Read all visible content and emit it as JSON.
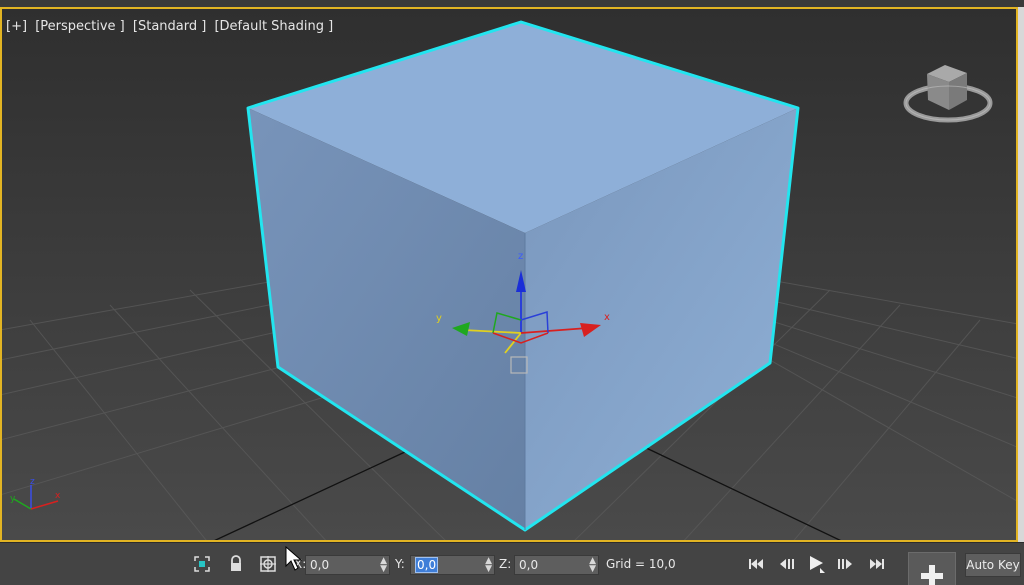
{
  "viewport": {
    "labels": [
      "[+]",
      "[Perspective ]",
      "[Standard ]",
      "[Default Shading ]"
    ],
    "gizmo_axes": {
      "x": "x",
      "y": "y",
      "z": "z"
    },
    "corner_axes": {
      "x": "x",
      "y": "y",
      "z": "z"
    }
  },
  "statusbar": {
    "x_label": "X:",
    "x_value": "0,0",
    "y_label": "Y:",
    "y_value": "0,0",
    "z_label": "Z:",
    "z_value": "0,0",
    "grid_text": "Grid = 10,0",
    "auto_key": "Auto Key"
  },
  "colors": {
    "viewport_border": "#e2b423",
    "selection_outline": "#22e5ef",
    "box_top": "#8eafd8",
    "box_left": "#6f8bb0",
    "box_right": "#7f9dc3"
  }
}
